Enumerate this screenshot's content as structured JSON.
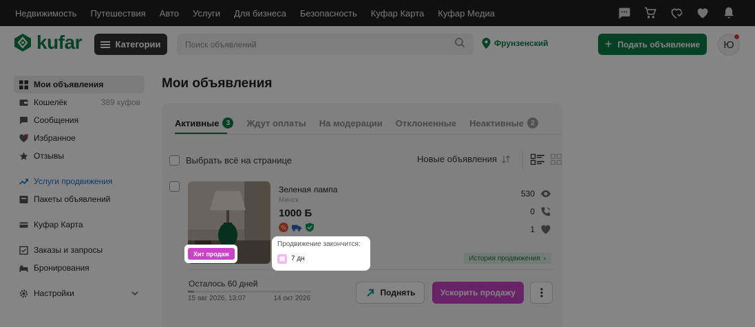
{
  "topbar": {
    "nav": [
      "Недвижимость",
      "Путешествия",
      "Авто",
      "Услуги",
      "Для бизнеса",
      "Безопасность",
      "Куфар Карта",
      "Куфар Медиа"
    ]
  },
  "header": {
    "logo_text": "kufar",
    "categories_label": "Категории",
    "search_placeholder": "Поиск объявлений",
    "location": "Фрунзенский",
    "post_button": "Подать объявление",
    "avatar_letter": "Ю"
  },
  "sidebar": {
    "items": [
      {
        "label": "Мои объявления",
        "icon": "grid-icon"
      },
      {
        "label": "Кошелёк",
        "extra": "389 куфов",
        "icon": "wallet-icon"
      },
      {
        "label": "Сообщения",
        "icon": "chat-icon"
      },
      {
        "label": "Избранное",
        "icon": "heart-icon"
      },
      {
        "label": "Отзывы",
        "icon": "star-icon"
      },
      {
        "label": "Услуги продвижения",
        "icon": "trend-up-icon"
      },
      {
        "label": "Пакеты объявлений",
        "icon": "package-icon"
      },
      {
        "label": "Куфар Карта",
        "icon": "card-icon"
      },
      {
        "label": "Заказы и запросы",
        "icon": "orders-icon"
      },
      {
        "label": "Бронирования",
        "icon": "bed-icon"
      },
      {
        "label": "Настройки",
        "icon": "settings-icon"
      }
    ]
  },
  "main": {
    "title": "Мои объявления",
    "tabs": [
      {
        "label": "Активные",
        "badge": "3"
      },
      {
        "label": "Ждут оплаты"
      },
      {
        "label": "На модерации"
      },
      {
        "label": "Отклоненные"
      },
      {
        "label": "Неактивные",
        "badge": "2"
      }
    ],
    "select_all": "Выбрать всё на странице",
    "sort_label": "Новые объявления"
  },
  "listing": {
    "badge": "Хит продаж",
    "title": "Зеленая лампа",
    "city": "Минск",
    "price": "1000 Б",
    "views": "530",
    "calls": "0",
    "favorites": "1",
    "history_label": "История продвижения",
    "remaining": "Осталось 60 дней",
    "progress_fraction": 0.05,
    "start_date": "15 авг 2026, 13:07",
    "end_date": "14 окт 2026",
    "raise_button": "Поднять",
    "boost_button": "Ускорить продажу"
  },
  "tooltip": {
    "label": "Продвижение закончится:",
    "value": "7 дн"
  },
  "colors": {
    "brand_green": "#0c7e4a",
    "promo_pink": "#c843c6",
    "topbar": "#1f1f1f"
  }
}
